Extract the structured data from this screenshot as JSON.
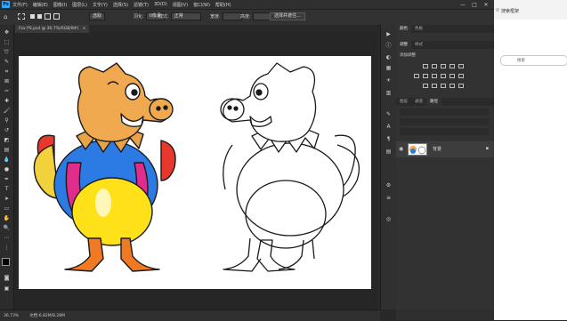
{
  "app": {
    "logo": "Ps",
    "accent": "#31a8ff"
  },
  "menu": [
    "文件(F)",
    "编辑(E)",
    "图像(I)",
    "图层(L)",
    "文字(Y)",
    "选择(S)",
    "滤镜(T)",
    "3D(D)",
    "视图(V)",
    "窗口(W)",
    "帮助(H)"
  ],
  "window_controls": {
    "minimize": "—",
    "maximize": "□",
    "close": "✕"
  },
  "options": {
    "tool_mode_value": "选取",
    "feather_label": "羽化:",
    "feather_value": "0像素",
    "style_label": "样式:",
    "style_value": "正常",
    "width_label": "宽度:",
    "height_label": "高度:",
    "select_mask_button": "选择并遮住..."
  },
  "document": {
    "tab": "Fox PS.psd @ 36.7%(RGB/8#)",
    "close_icon": "×"
  },
  "status": {
    "zoom": "36.73%",
    "doc_info": "文档:6.82M/8.28M"
  },
  "panels": {
    "color_tabs": [
      "颜色",
      "色板"
    ],
    "adjust_tabs": [
      "调整",
      "样式"
    ],
    "adjust_title": "添加调整",
    "layer_tabs": [
      "图层",
      "通道",
      "路径"
    ],
    "layer_name": "背景",
    "lock_icon": "🔒"
  },
  "browser": {
    "title": "搜索框架",
    "search_placeholder": "搜索"
  },
  "colors": {
    "fg": "#000000",
    "bg": "#ffffff"
  }
}
